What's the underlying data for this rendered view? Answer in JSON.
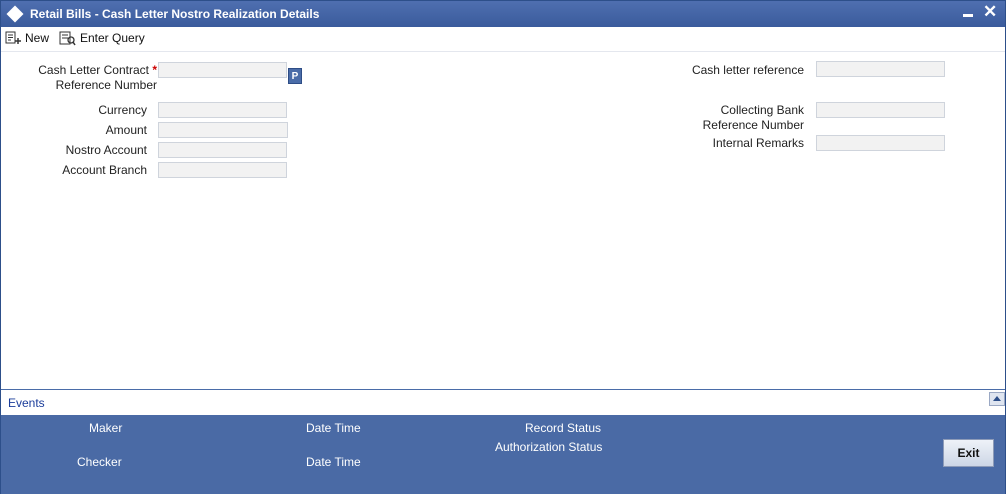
{
  "window": {
    "title": "Retail Bills - Cash Letter Nostro Realization Details",
    "close_glyph": "✕"
  },
  "toolbar": {
    "new_label": "New",
    "enter_query_label": "Enter Query"
  },
  "form": {
    "left": {
      "ref_label_line1": "Cash Letter Contract",
      "ref_required": "*",
      "ref_label_line2": "Reference Number",
      "ref_value": "",
      "lov_label": "P",
      "currency_label": "Currency",
      "currency_value": "",
      "amount_label": "Amount",
      "amount_value": "",
      "nostro_account_label": "Nostro Account",
      "nostro_account_value": "",
      "account_branch_label": "Account Branch",
      "account_branch_value": ""
    },
    "right": {
      "cash_letter_ref_label": "Cash letter reference",
      "cash_letter_ref_value": "",
      "collecting_bank_label_line1": "Collecting Bank",
      "collecting_bank_label_line2": "Reference Number",
      "collecting_bank_value": "",
      "internal_remarks_label": "Internal Remarks",
      "internal_remarks_value": ""
    }
  },
  "events": {
    "label": "Events"
  },
  "footer": {
    "maker_label": "Maker",
    "maker_datetime_label": "Date Time",
    "checker_label": "Checker",
    "checker_datetime_label": "Date Time",
    "record_status_label": "Record Status",
    "authorization_status_label": "Authorization Status",
    "exit_label": "Exit"
  },
  "colors": {
    "titlebar": "#3a5b9c",
    "footer": "#4a6aa5",
    "required": "#cc0000",
    "link": "#1a3c9a"
  }
}
